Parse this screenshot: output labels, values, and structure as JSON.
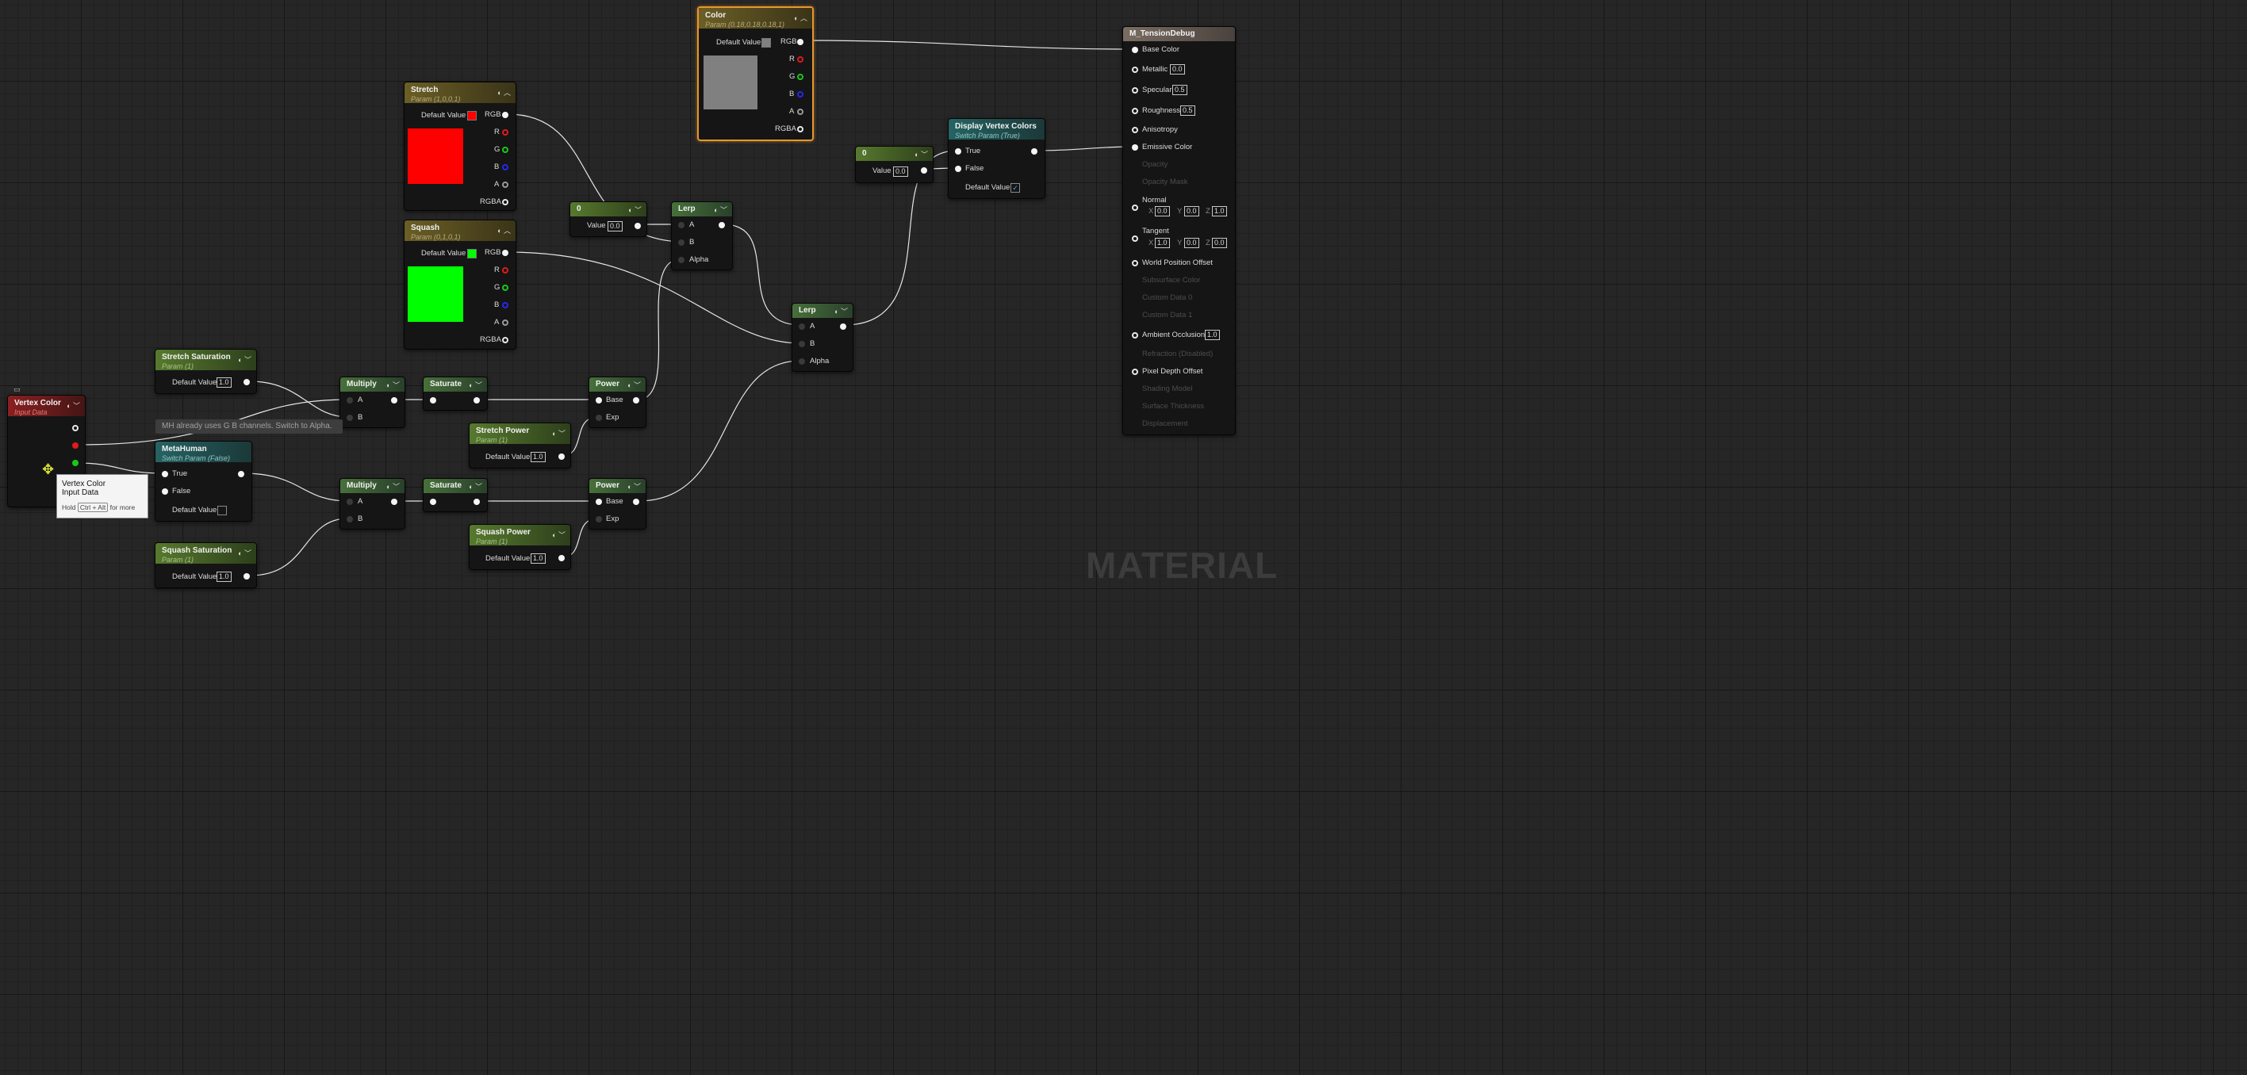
{
  "color_node": {
    "title": "Color",
    "subtitle": "Param (0.18,0.18,0.18,1)",
    "default_label": "Default Value",
    "swatch": "#808080",
    "outs": [
      "RGB",
      "R",
      "G",
      "B",
      "A",
      "RGBA"
    ]
  },
  "stretch_node": {
    "title": "Stretch",
    "subtitle": "Param (1,0,0,1)",
    "default_label": "Default Value",
    "swatch": "#ff0000",
    "outs": [
      "RGB",
      "R",
      "G",
      "B",
      "A",
      "RGBA"
    ]
  },
  "squash_node": {
    "title": "Squash",
    "subtitle": "Param (0,1,0,1)",
    "default_label": "Default Value",
    "swatch": "#00ff00",
    "outs": [
      "RGB",
      "R",
      "G",
      "B",
      "A",
      "RGBA"
    ]
  },
  "scalar_zero_1": {
    "title": "0",
    "value_label": "Value",
    "value": "0.0"
  },
  "scalar_zero_2": {
    "title": "0",
    "value_label": "Value",
    "value": "0.0"
  },
  "lerp_1": {
    "title": "Lerp",
    "inputs": [
      "A",
      "B",
      "Alpha"
    ]
  },
  "lerp_2": {
    "title": "Lerp",
    "inputs": [
      "A",
      "B",
      "Alpha"
    ]
  },
  "display_vertex_colors": {
    "title": "Display Vertex Colors",
    "subtitle": "Switch Param (True)",
    "inputs": [
      "True",
      "False"
    ],
    "default_label": "Default Value",
    "checked": true,
    "check_glyph": "✓"
  },
  "material_result": {
    "title": "M_TensionDebug",
    "pins": [
      {
        "label": "Base Color",
        "active": true
      },
      {
        "label": "Metallic",
        "active": true,
        "value": "0.0"
      },
      {
        "label": "Specular",
        "active": true,
        "value": "0.5"
      },
      {
        "label": "Roughness",
        "active": true,
        "value": "0.5"
      },
      {
        "label": "Anisotropy",
        "active": true
      },
      {
        "label": "Emissive Color",
        "active": true
      },
      {
        "label": "Opacity",
        "active": false
      },
      {
        "label": "Opacity Mask",
        "active": false
      },
      {
        "label": "Normal",
        "active": true,
        "xyz": [
          "0.0",
          "0.0",
          "1.0"
        ]
      },
      {
        "label": "Tangent",
        "active": true,
        "xyz": [
          "1.0",
          "0.0",
          "0.0"
        ]
      },
      {
        "label": "World Position Offset",
        "active": true
      },
      {
        "label": "Subsurface Color",
        "active": false
      },
      {
        "label": "Custom Data 0",
        "active": false
      },
      {
        "label": "Custom Data 1",
        "active": false
      },
      {
        "label": "Ambient Occlusion",
        "active": true,
        "value": "1.0"
      },
      {
        "label": "Refraction (Disabled)",
        "active": false
      },
      {
        "label": "Pixel Depth Offset",
        "active": true
      },
      {
        "label": "Shading Model",
        "active": false
      },
      {
        "label": "Surface Thickness",
        "active": false
      },
      {
        "label": "Displacement",
        "active": false
      }
    ],
    "axis": [
      "X",
      "Y",
      "Z"
    ]
  },
  "stretch_saturation": {
    "title": "Stretch Saturation",
    "subtitle": "Param (1)",
    "default_label": "Default Value",
    "value": "1.0"
  },
  "squash_saturation": {
    "title": "Squash Saturation",
    "subtitle": "Param (1)",
    "default_label": "Default Value",
    "value": "1.0"
  },
  "multiply_1": {
    "title": "Multiply",
    "inputs": [
      "A",
      "B"
    ]
  },
  "multiply_2": {
    "title": "Multiply",
    "inputs": [
      "A",
      "B"
    ]
  },
  "saturate_1": {
    "title": "Saturate"
  },
  "saturate_2": {
    "title": "Saturate"
  },
  "power_1": {
    "title": "Power",
    "inputs": [
      "Base",
      "Exp"
    ]
  },
  "power_2": {
    "title": "Power",
    "inputs": [
      "Base",
      "Exp"
    ]
  },
  "stretch_power": {
    "title": "Stretch Power",
    "subtitle": "Param (1)",
    "default_label": "Default Value",
    "value": "1.0"
  },
  "squash_power": {
    "title": "Squash Power",
    "subtitle": "Param (1)",
    "default_label": "Default Value",
    "value": "1.0"
  },
  "vertex_color": {
    "title": "Vertex Color",
    "subtitle": "Input Data"
  },
  "metahuman": {
    "title": "MetaHuman",
    "subtitle": "Switch Param (False)",
    "inputs": [
      "True",
      "False"
    ],
    "default_label": "Default Value"
  },
  "comment": {
    "text": "MH already uses G B channels. Switch to Alpha."
  },
  "tooltip": {
    "line1": "Vertex Color",
    "line2": "Input Data",
    "hold": "Hold",
    "keys": "Ctrl + Alt",
    "for_more": "for more"
  },
  "watermark": {
    "text": "MATERIAL"
  },
  "colors": {
    "wire": "#e6e6e6",
    "selection": "#e8962a",
    "red_pin": "#e21a1a",
    "green_pin": "#18c918",
    "blue_pin": "#2727ef"
  },
  "icons": [
    "preview-toggle-icon",
    "collapse-chevron-icon",
    "expand-chevron-icon",
    "move-cursor-icon",
    "comment-bubble-icon",
    "checkmark-icon"
  ]
}
